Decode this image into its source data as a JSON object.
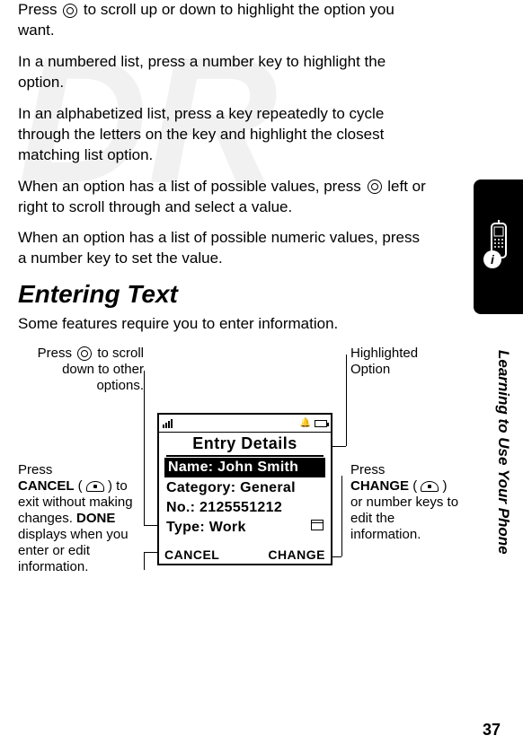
{
  "paragraphs": {
    "p1a": "Press ",
    "p1b": " to scroll up or down to highlight the option you want.",
    "p2": "In a numbered list, press a number key to highlight the option.",
    "p3": "In an alphabetized list, press a key repeatedly to cycle through the letters on the key and highlight the closest matching list option.",
    "p4a": "When an option has a list of possible values, press ",
    "p4b": " left or right to scroll through and select a value.",
    "p5": "When an option has a list of possible numeric values, press a number key to set the value.",
    "intro": "Some features require you to enter information."
  },
  "heading": "Entering Text",
  "sidebar": "Learning to Use Your Phone",
  "page_number": "37",
  "callouts": {
    "top_left_a": "Press ",
    "top_left_b": " to scroll down to other options.",
    "top_right_a": "Highlighted",
    "top_right_b": "Option",
    "left_a": "Press ",
    "left_cancel": "CANCEL",
    "left_b": " (",
    "left_c": ") to exit without making changes. ",
    "left_done": "DONE",
    "left_d": " displays when you enter or edit information.",
    "right_a": "Press ",
    "right_change": "CHANGE",
    "right_b": " (",
    "right_c": ") or number keys to edit the information."
  },
  "phone_screen": {
    "title": "Entry Details",
    "rows": {
      "name": "Name: John Smith",
      "category": "Category: General",
      "number": "No.: 2125551212",
      "type": "Type: Work"
    },
    "softkeys": {
      "left": "CANCEL",
      "right": "CHANGE"
    }
  }
}
